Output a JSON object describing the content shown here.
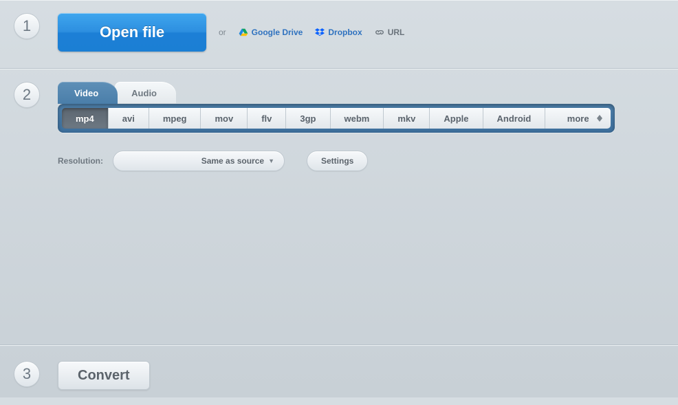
{
  "step1": {
    "badge": "1",
    "open_label": "Open file",
    "or_text": "or",
    "sources": {
      "gdrive": "Google Drive",
      "dropbox": "Dropbox",
      "url": "URL"
    }
  },
  "step2": {
    "badge": "2",
    "tabs": {
      "video": "Video",
      "audio": "Audio"
    },
    "formats": [
      "mp4",
      "avi",
      "mpeg",
      "mov",
      "flv",
      "3gp",
      "webm",
      "mkv",
      "Apple",
      "Android",
      "more"
    ],
    "active_format_index": 0,
    "resolution_label": "Resolution:",
    "resolution_value": "Same as source",
    "settings_label": "Settings"
  },
  "step3": {
    "badge": "3",
    "convert_label": "Convert"
  }
}
